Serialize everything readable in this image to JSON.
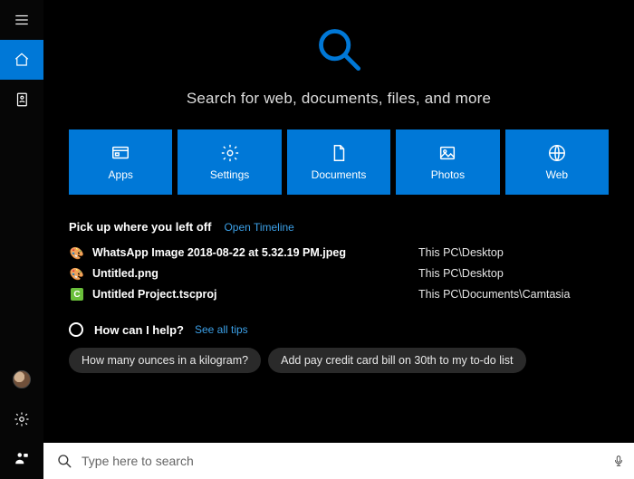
{
  "colors": {
    "accent": "#0078d7",
    "link": "#3ca0e7"
  },
  "hero": {
    "tagline": "Search for web, documents, files, and more"
  },
  "tiles": [
    {
      "id": "apps",
      "label": "Apps"
    },
    {
      "id": "settings",
      "label": "Settings"
    },
    {
      "id": "documents",
      "label": "Documents"
    },
    {
      "id": "photos",
      "label": "Photos"
    },
    {
      "id": "web",
      "label": "Web"
    }
  ],
  "pickup": {
    "title": "Pick up where you left off",
    "link_label": "Open Timeline",
    "items": [
      {
        "icon": "image",
        "name": "WhatsApp Image 2018-08-22 at 5.32.19 PM.jpeg",
        "location": "This PC\\Desktop"
      },
      {
        "icon": "image",
        "name": "Untitled.png",
        "location": "This PC\\Desktop"
      },
      {
        "icon": "project",
        "name": "Untitled Project.tscproj",
        "location": "This PC\\Documents\\Camtasia"
      }
    ]
  },
  "help": {
    "title": "How can I help?",
    "link_label": "See all tips",
    "chips": [
      "How many ounces in a kilogram?",
      "Add pay credit card bill on 30th to my to-do list"
    ]
  },
  "search": {
    "placeholder": "Type here to search"
  }
}
